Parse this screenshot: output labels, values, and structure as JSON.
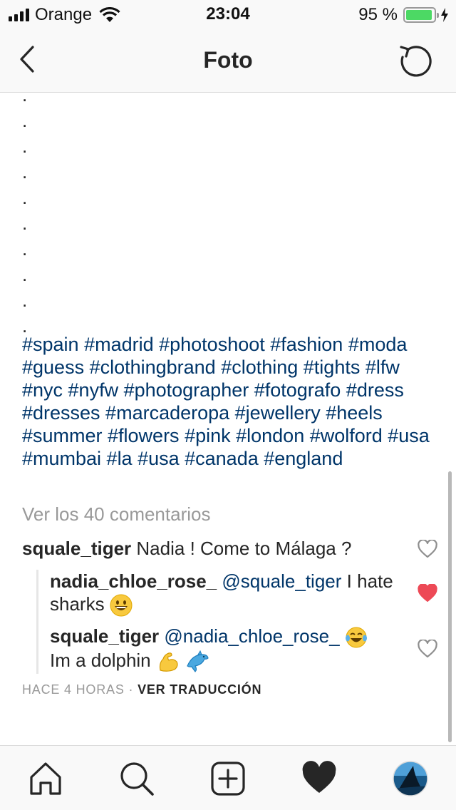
{
  "status_bar": {
    "carrier": "Orange",
    "time": "23:04",
    "battery_percent": "95 %",
    "battery_level": 0.95,
    "colors": {
      "battery_fill": "#4cd964"
    }
  },
  "nav": {
    "title": "Foto",
    "back_icon": "chevron-left-icon",
    "refresh_icon": "refresh-icon"
  },
  "caption": {
    "dots": [
      ".",
      ".",
      ".",
      ".",
      ".",
      ".",
      ".",
      ".",
      ".",
      "."
    ],
    "hashtags": "#spain #madrid #photoshoot #fashion #moda #guess #clothingbrand #clothing #tights #lfw #nyc #nyfw #photographer #fotografo #dress #dresses #marcaderopa #jewellery #heels #summer #flowers #pink #london #wolford #usa #mumbai #la #usa #canada #england"
  },
  "comments": {
    "view_all": "Ver los 40 comentarios",
    "items": [
      {
        "user": "squale_tiger",
        "text": "Nadia ! Come to Málaga ?",
        "liked": false
      },
      {
        "user": "nadia_chloe_rose_",
        "mention": "@squale_tiger",
        "text": "I hate sharks",
        "emoji": "grinning-face",
        "liked": true
      },
      {
        "user": "squale_tiger",
        "mention": "@nadia_chloe_rose_",
        "text": "Im a dolphin",
        "emojis": [
          "laughing-tears-face",
          "flexed-biceps",
          "dolphin"
        ],
        "liked": false
      }
    ],
    "timestamp": "HACE 4 HORAS",
    "separator": "·",
    "translate": "VER TRADUCCIÓN"
  },
  "tab_bar": {
    "items": [
      "home-icon",
      "search-icon",
      "add-icon",
      "activity-heart-icon",
      "profile-avatar"
    ]
  },
  "colors": {
    "hashtag": "#003569",
    "like_active": "#ed4956",
    "muted_text": "#999999"
  }
}
